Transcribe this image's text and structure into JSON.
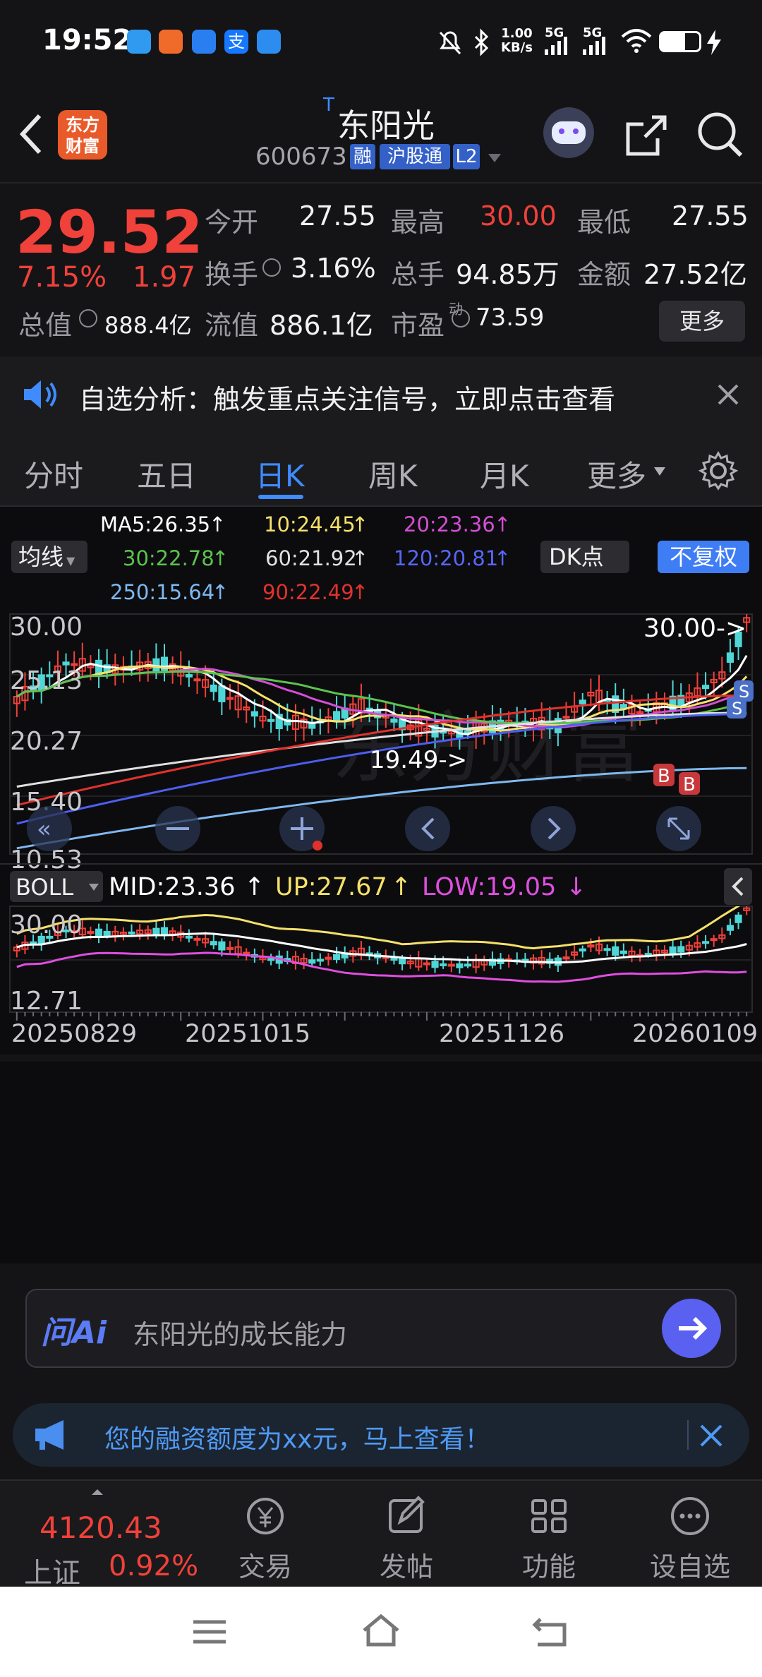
{
  "status_bar": {
    "time": "19:52",
    "net_speed_value": "1.00",
    "net_speed_unit": "KB/s",
    "signal1": "5G",
    "signal2": "5G"
  },
  "header": {
    "brand_line1": "东方",
    "brand_line2": "财富",
    "title_mark": "T",
    "title": "东阳光",
    "code": "600673",
    "tag_margin": "融",
    "tag_hgt": "沪股通",
    "tag_l2": "L2"
  },
  "quote": {
    "price": "29.52",
    "change_pct": "7.15%",
    "change_amt": "1.97",
    "open_label": "今开",
    "open_value": "27.55",
    "high_label": "最高",
    "high_value": "30.00",
    "low_label": "最低",
    "low_value": "27.55",
    "turnover_label": "换手",
    "turnover_value": "3.16%",
    "volume_label": "总手",
    "volume_value": "94.85万",
    "amount_label": "金额",
    "amount_value": "27.52亿",
    "mktcap_label": "总值",
    "mktcap_value": "888.4亿",
    "float_label": "流值",
    "float_value": "886.1亿",
    "pe_label": "市盈",
    "pe_sup": "动",
    "pe_value": "73.59",
    "more_button": "更多"
  },
  "notice": {
    "text": "自选分析：触发重点关注信号，立即点击查看"
  },
  "tabs": [
    "分时",
    "五日",
    "日K",
    "周K",
    "月K",
    "更多"
  ],
  "active_tab": "日K",
  "chart_panel": {
    "ma_selector": "均线",
    "ma5": "MA5:26.35",
    "ma10": "10:24.45",
    "ma20": "20:23.36",
    "ma30": "30:22.78",
    "ma60": "60:21.92",
    "ma120": "120:20.81",
    "ma250": "250:15.64",
    "ma90": "90:22.49",
    "dk_button": "DK点",
    "adjust_button": "不复权",
    "y_labels": [
      "30.00",
      "25.13",
      "20.27",
      "15.40",
      "10.53"
    ],
    "max_label": "30.00->",
    "min_label": "19.49->",
    "boll_selector": "BOLL",
    "boll_mid": "MID:23.36",
    "boll_up": "UP:27.67",
    "boll_low": "LOW:19.05",
    "boll_y_labels": [
      "30.00",
      "12.71"
    ],
    "x_dates": [
      "20250829",
      "20251015",
      "20251126",
      "20260109"
    ],
    "signals": [
      "S",
      "S",
      "B",
      "B"
    ]
  },
  "colors": {
    "up": "#f0413a",
    "down": "#4fd6d6",
    "ma5": "#ffffff",
    "ma10": "#f5e16a",
    "ma20": "#d44ed6",
    "ma30": "#5cc34e",
    "ma60": "#e0e0e0",
    "ma120": "#4d5ef0",
    "ma250": "#7fb8f0",
    "ma90": "#e0322d",
    "accent": "#3f7df5"
  },
  "ai_bar": {
    "logo": "问Ai",
    "placeholder": "东阳光的成长能力"
  },
  "promo": {
    "text": "您的融资额度为xx元，马上查看！"
  },
  "bottom_nav": {
    "index_value": "4120.43",
    "index_name": "上证",
    "index_change": "0.92%",
    "items": [
      "交易",
      "发帖",
      "功能",
      "设自选"
    ]
  }
}
